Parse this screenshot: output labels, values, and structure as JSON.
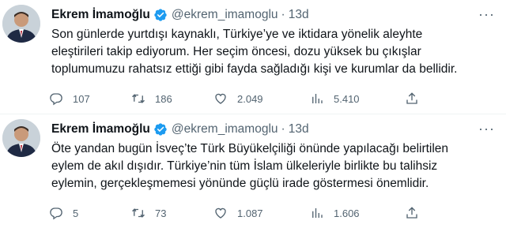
{
  "tweets": [
    {
      "author": {
        "name": "Ekrem İmamoğlu",
        "handle": "@ekrem_imamoglu",
        "time": "13d",
        "verified": true
      },
      "lines": [
        "Son günlerde yurtdışı kaynaklı, Türkiye’ye ve iktidara yönelik aleyhte",
        "eleştirileri takip ediyorum. Her seçim öncesi, dozu yüksek bu çıkışlar",
        "toplumumuzu rahatsız ettiği gibi fayda sağladığı kişi ve kurumlar da bellidir."
      ],
      "stats": {
        "replies": "107",
        "retweets": "186",
        "likes": "2.049",
        "views": "5.410"
      }
    },
    {
      "author": {
        "name": "Ekrem İmamoğlu",
        "handle": "@ekrem_imamoglu",
        "time": "13d",
        "verified": true
      },
      "lines": [
        "Öte yandan bugün İsveç’te Türk Büyükelçiliği önünde yapılacağı belirtilen",
        "eylem de akıl dışıdır. Türkiye’nin tüm İslam ülkeleriyle birlikte bu talihsiz",
        "eylemin, gerçekleşmemesi yönünde güçlü irade göstermesi önemlidir."
      ],
      "stats": {
        "replies": "5",
        "retweets": "73",
        "likes": "1.087",
        "views": "1.606"
      }
    }
  ],
  "colors": {
    "text": "#0f1419",
    "secondary": "#536471",
    "verified": "#1d9bf0"
  },
  "icons": [
    "more-icon",
    "verified-badge-icon",
    "reply-icon",
    "retweet-icon",
    "like-icon",
    "views-icon",
    "share-icon"
  ]
}
